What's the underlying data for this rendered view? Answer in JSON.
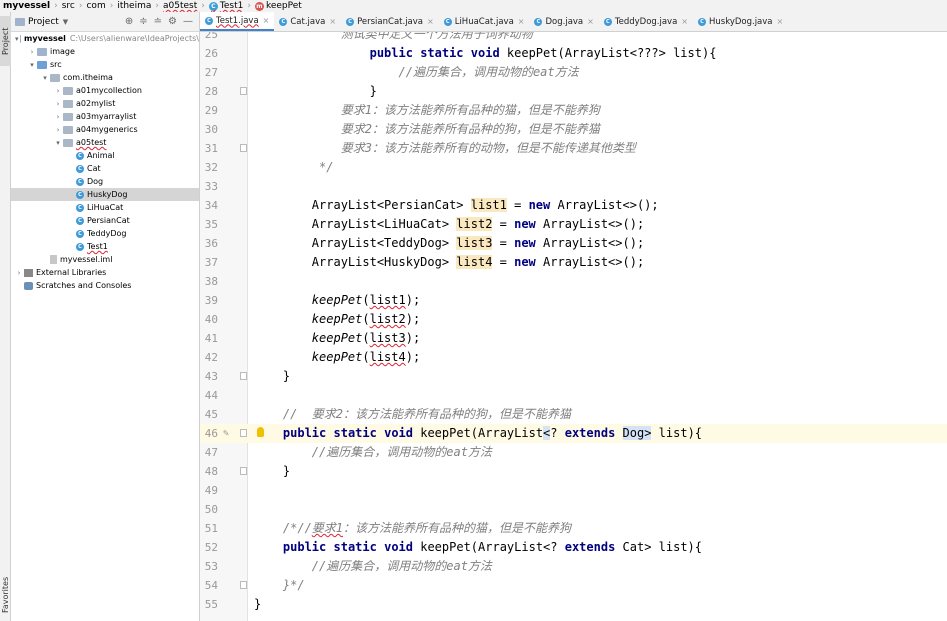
{
  "breadcrumbs": [
    "myvessel",
    "src",
    "com",
    "itheima",
    "a05test",
    "Test1",
    "keepPet"
  ],
  "side_tabs": {
    "project": "Project",
    "favorites": "Favorites"
  },
  "project_panel": {
    "title": "Project",
    "tree": [
      {
        "label": "myvessel",
        "extra": "C:\\Users\\alienware\\IdeaProjects\\",
        "depth": 0,
        "arrow": "▾",
        "icon": "folder"
      },
      {
        "label": "image",
        "depth": 1,
        "arrow": "›",
        "icon": "folder"
      },
      {
        "label": "src",
        "depth": 1,
        "arrow": "▾",
        "icon": "folder-src"
      },
      {
        "label": "com.itheima",
        "depth": 2,
        "arrow": "▾",
        "icon": "package"
      },
      {
        "label": "a01mycollection",
        "depth": 3,
        "arrow": "›",
        "icon": "package"
      },
      {
        "label": "a02mylist",
        "depth": 3,
        "arrow": "›",
        "icon": "package"
      },
      {
        "label": "a03myarraylist",
        "depth": 3,
        "arrow": "›",
        "icon": "package"
      },
      {
        "label": "a04mygenerics",
        "depth": 3,
        "arrow": "›",
        "icon": "package"
      },
      {
        "label": "a05test",
        "depth": 3,
        "arrow": "▾",
        "icon": "package",
        "underline": true
      },
      {
        "label": "Animal",
        "depth": 4,
        "icon": "class"
      },
      {
        "label": "Cat",
        "depth": 4,
        "icon": "class"
      },
      {
        "label": "Dog",
        "depth": 4,
        "icon": "class"
      },
      {
        "label": "HuskyDog",
        "depth": 4,
        "icon": "class",
        "selected": true
      },
      {
        "label": "LiHuaCat",
        "depth": 4,
        "icon": "class"
      },
      {
        "label": "PersianCat",
        "depth": 4,
        "icon": "class"
      },
      {
        "label": "TeddyDog",
        "depth": 4,
        "icon": "class"
      },
      {
        "label": "Test1",
        "depth": 4,
        "icon": "class",
        "underline": true
      },
      {
        "label": "myvessel.iml",
        "depth": 2,
        "icon": "file"
      },
      {
        "label": "External Libraries",
        "depth": 0,
        "arrow": "›",
        "icon": "library"
      },
      {
        "label": "Scratches and Consoles",
        "depth": 0,
        "icon": "scratch"
      }
    ]
  },
  "tabs": [
    {
      "label": "Test1.java",
      "active": true,
      "error": true
    },
    {
      "label": "Cat.java"
    },
    {
      "label": "PersianCat.java"
    },
    {
      "label": "LiHuaCat.java"
    },
    {
      "label": "Dog.java"
    },
    {
      "label": "TeddyDog.java"
    },
    {
      "label": "HuskyDog.java"
    }
  ],
  "code_lines": [
    {
      "n": "25",
      "html": "            测试类中定义一个方法用于饲养动物"
    },
    {
      "n": "26",
      "html": "                public static void keepPet(ArrayList<???> list){"
    },
    {
      "n": "27",
      "html": "                    //遍历集合，调用动物的eat方法"
    },
    {
      "n": "28",
      "html": "                }"
    },
    {
      "n": "29",
      "html": "            要求1：该方法能养所有品种的猫，但是不能养狗"
    },
    {
      "n": "30",
      "html": "            要求2：该方法能养所有品种的狗，但是不能养猫"
    },
    {
      "n": "31",
      "html": "            要求3：该方法能养所有的动物，但是不能传递其他类型"
    },
    {
      "n": "32",
      "html": "         */"
    },
    {
      "n": "33",
      "html": ""
    },
    {
      "n": "34",
      "html": "        ArrayList<PersianCat> list1 = new ArrayList<>();"
    },
    {
      "n": "35",
      "html": "        ArrayList<LiHuaCat> list2 = new ArrayList<>();"
    },
    {
      "n": "36",
      "html": "        ArrayList<TeddyDog> list3 = new ArrayList<>();"
    },
    {
      "n": "37",
      "html": "        ArrayList<HuskyDog> list4 = new ArrayList<>();"
    },
    {
      "n": "38",
      "html": ""
    },
    {
      "n": "39",
      "html": "        keepPet(list1);"
    },
    {
      "n": "40",
      "html": "        keepPet(list2);"
    },
    {
      "n": "41",
      "html": "        keepPet(list3);"
    },
    {
      "n": "42",
      "html": "        keepPet(list4);"
    },
    {
      "n": "43",
      "html": "    }"
    },
    {
      "n": "44",
      "html": ""
    },
    {
      "n": "45",
      "html": "    //  要求2：该方法能养所有品种的狗，但是不能养猫"
    },
    {
      "n": "46",
      "html": "    public static void keepPet(ArrayList<? extends Dog> list){"
    },
    {
      "n": "47",
      "html": "        //遍历集合，调用动物的eat方法"
    },
    {
      "n": "48",
      "html": "    }"
    },
    {
      "n": "49",
      "html": ""
    },
    {
      "n": "50",
      "html": ""
    },
    {
      "n": "51",
      "html": "    /*//要求1：该方法能养所有品种的猫，但是不能养狗"
    },
    {
      "n": "52",
      "html": "    public static void keepPet(ArrayList<? extends Cat> list){"
    },
    {
      "n": "53",
      "html": "        //遍历集合，调用动物的eat方法"
    },
    {
      "n": "54",
      "html": "    }*/"
    },
    {
      "n": "55",
      "html": "}"
    }
  ],
  "colors": {
    "keyword": "#000080",
    "comment": "#808080",
    "current_line": "#fffae3",
    "highlight": "#f9e8c0"
  }
}
